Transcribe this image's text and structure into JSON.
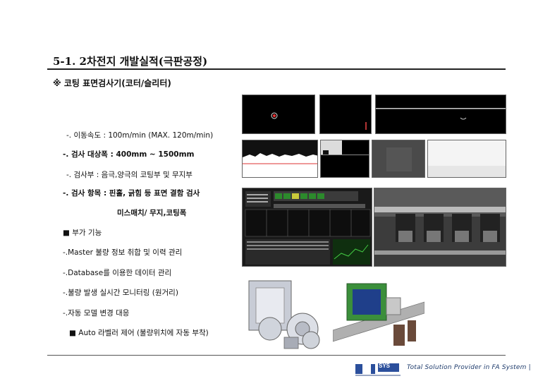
{
  "page": {
    "title": "5-1. 2차전지 개발실적(극판공정)",
    "subtitle": "※ 코팅 표면검사기(코터/슬리터)"
  },
  "specs": [
    "-. 이동속도 : 100m/min (MAX. 120m/min)",
    "-. 검사 대상폭 : 400mm ~ 1500mm",
    "-. 검사부 : 음극,양극의  코팅부 및 무지부",
    "-. 검사 항목 : 핀홀, 긁힘 등 표면 결함 검사",
    "미스매치/ 무지,코팅폭"
  ],
  "features_header": "■ 부가 기능",
  "features": [
    "-.Master 불량 정보 취합 및 이력 관리",
    "-.Database를 이용한 데이터 관리",
    "-.불량 발생 실시간 모니터링 (원거리)",
    "-.자동 모델 변경 대응",
    "■ Auto 라벨러 제어 (불량위치에 자동 부착)"
  ],
  "footer": {
    "tagline": "Total Solution Provider in FA System |",
    "logo_text": "SYS"
  },
  "colors": {
    "footer_text": "#1d3a6b",
    "logo_blue": "#2b4f9c",
    "photo_bg": "#000000"
  }
}
